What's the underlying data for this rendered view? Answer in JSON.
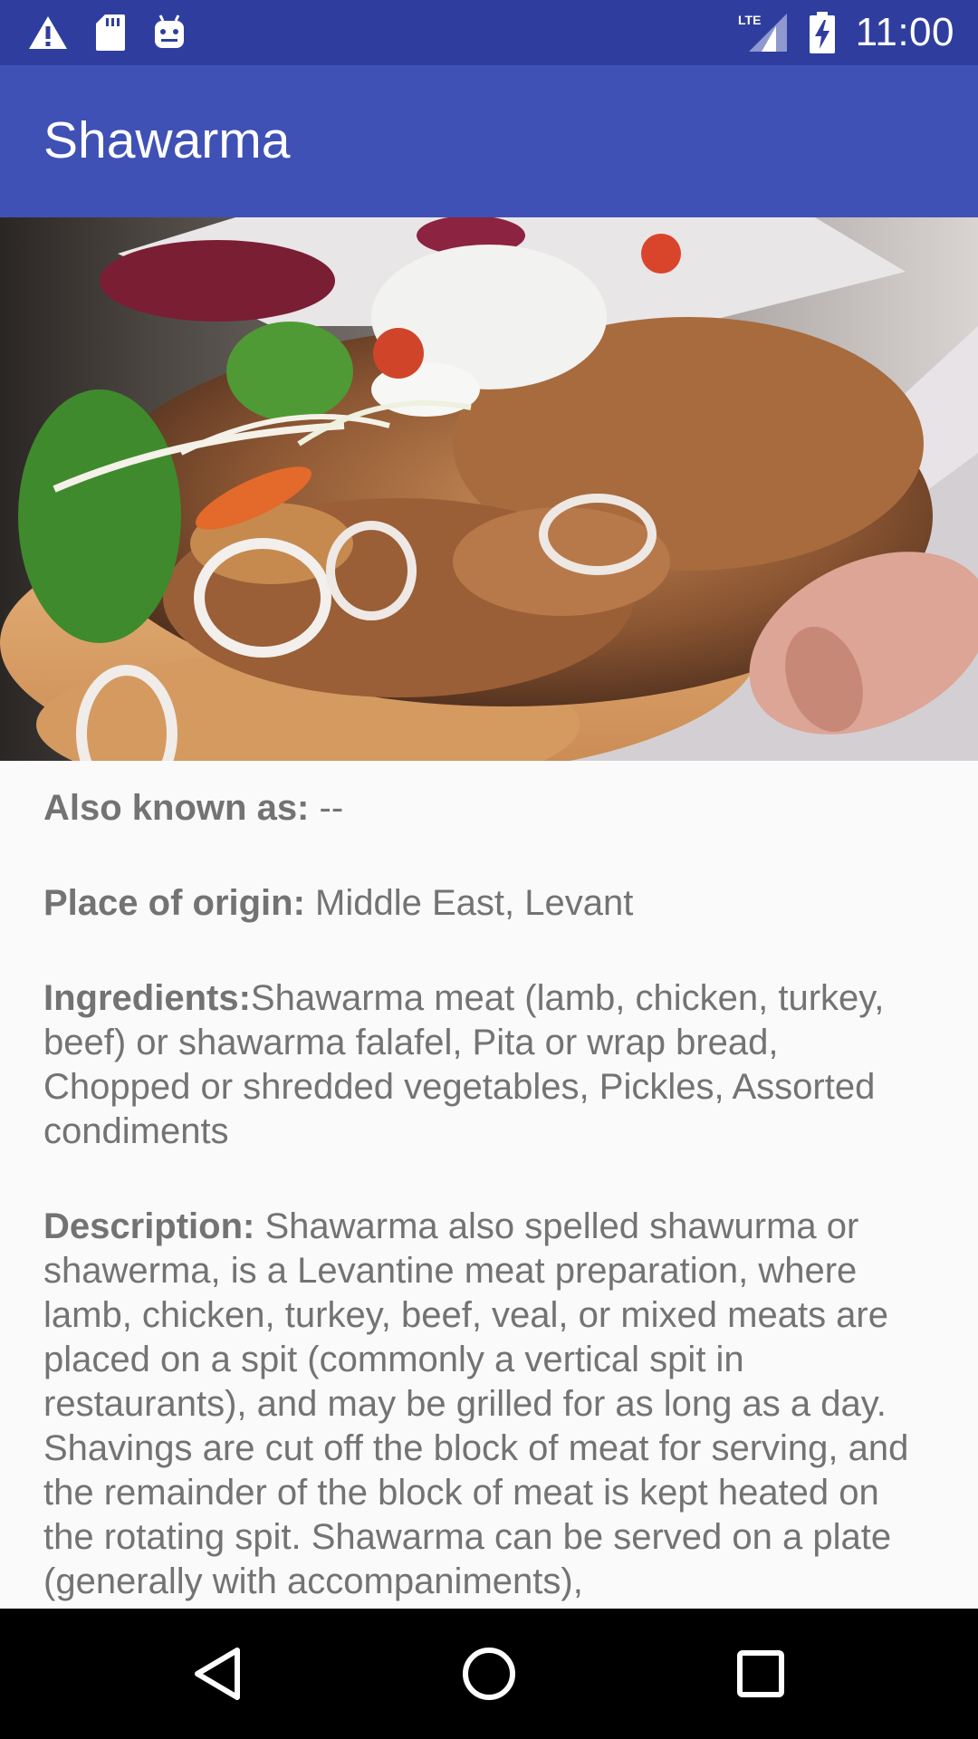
{
  "status_bar": {
    "left_icons": [
      "warning-icon",
      "sd-card-icon",
      "android-debug-icon"
    ],
    "network_label": "LTE",
    "right_icons": [
      "lte-signal-icon",
      "battery-charging-icon"
    ],
    "time": "11:00"
  },
  "app_bar": {
    "title": "Shawarma",
    "color": "#3f51b5",
    "status_color": "#2f3e9e"
  },
  "hero": {
    "subject": "shawarma-photo"
  },
  "details": {
    "also_known_as": {
      "label": "Also known as:",
      "value": " --"
    },
    "place_of_origin": {
      "label": "Place of origin:",
      "value": " Middle East, Levant"
    },
    "ingredients": {
      "label": "Ingredients:",
      "value": "Shawarma meat (lamb, chicken, turkey, beef) or shawarma falafel, Pita or wrap bread, Chopped or shredded vegetables, Pickles, Assorted condiments"
    },
    "description": {
      "label": "Description:",
      "value": " Shawarma also spelled shawurma or shawerma, is a Levantine meat preparation, where lamb, chicken, turkey, beef, veal, or mixed meats are placed on a spit (commonly a vertical spit in restaurants), and may be grilled for as long as a day. Shavings are cut off the block of meat for serving, and the remainder of the block of meat is kept heated on the rotating spit. Shawarma can be served on a plate (generally with accompaniments),"
    }
  },
  "nav_bar": {
    "buttons": [
      "back-icon",
      "home-icon",
      "recents-icon"
    ]
  }
}
